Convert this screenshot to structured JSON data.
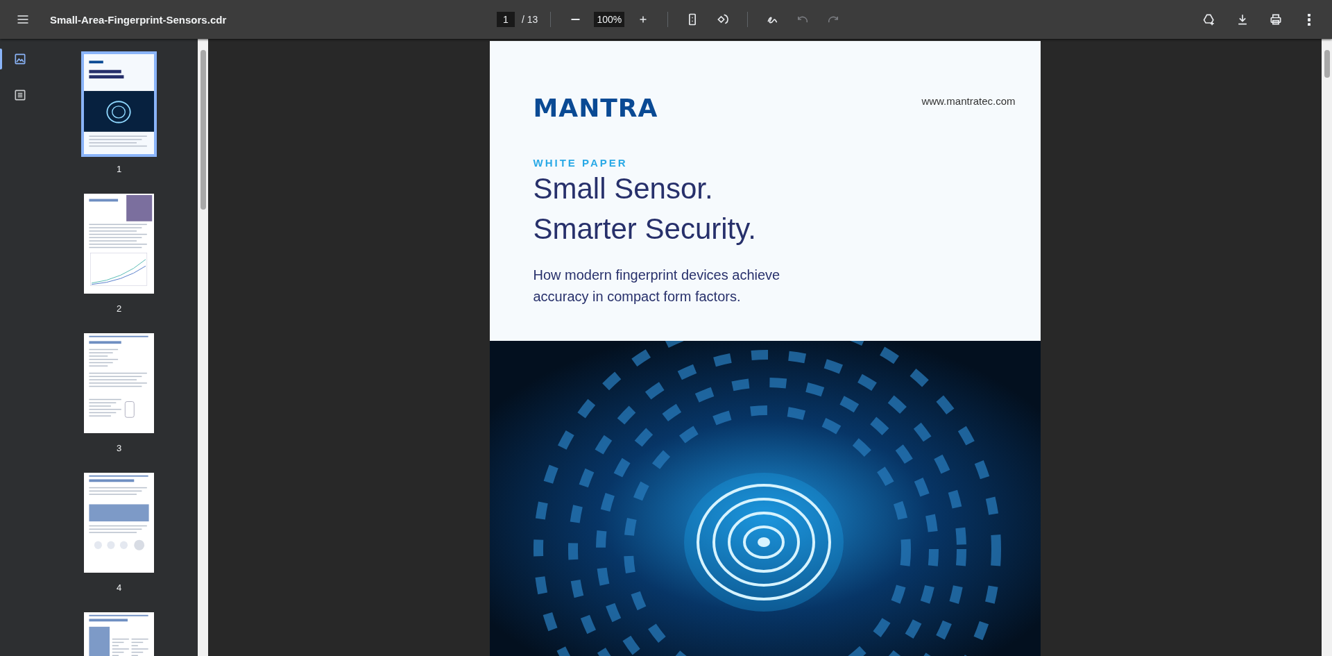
{
  "toolbar": {
    "title": "Small-Area-Fingerprint-Sensors.cdr",
    "page_input": "1",
    "page_count": "/ 13",
    "zoom": "100%",
    "undo": {
      "disabled": true
    },
    "redo": {
      "disabled": true
    }
  },
  "sidebar": {
    "tabs": [
      {
        "kind": "thumbnails",
        "selected": true
      },
      {
        "kind": "outline",
        "selected": false
      }
    ],
    "thumbnails": [
      {
        "kind": "cover",
        "label": "1",
        "selected": true
      },
      {
        "kind": "chart",
        "label": "2",
        "selected": false
      },
      {
        "kind": "text",
        "label": "3",
        "selected": false
      },
      {
        "kind": "table",
        "label": "4",
        "selected": false
      },
      {
        "kind": "columns",
        "selected": false
      }
    ]
  },
  "page": {
    "logo": "MANTRA",
    "url": "www.mantratec.com",
    "eyebrow": "WHITE PAPER",
    "title_lines": [
      "Small Sensor.",
      "Smarter Security."
    ],
    "subtitle": "How modern fingerprint devices achieve accuracy in compact form factors."
  }
}
